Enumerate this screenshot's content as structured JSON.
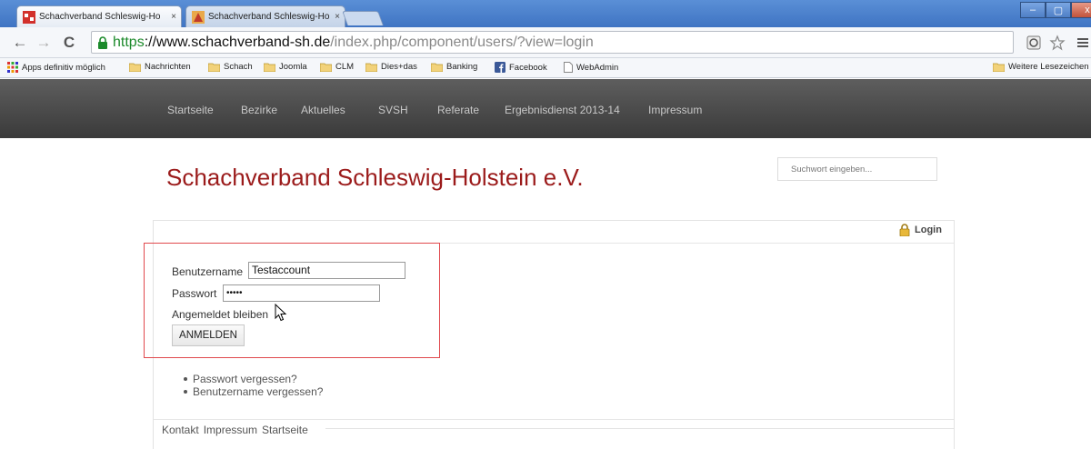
{
  "browser": {
    "tabs": [
      {
        "title": "Schachverband Schleswig-Ho",
        "close": "×"
      },
      {
        "title": "Schachverband Schleswig-Ho",
        "close": "×"
      }
    ],
    "url": {
      "scheme": "https",
      "host": "://www.schachverband-sh.de",
      "path": "/index.php/component/users/?view=login"
    },
    "bookmarks": [
      {
        "label": "Apps definitiv möglich",
        "icon": "apps-grid-icon"
      },
      {
        "label": "Nachrichten",
        "icon": "folder-icon"
      },
      {
        "label": "Schach",
        "icon": "folder-icon"
      },
      {
        "label": "Joomla",
        "icon": "folder-icon"
      },
      {
        "label": "CLM",
        "icon": "folder-icon"
      },
      {
        "label": "Dies+das",
        "icon": "folder-icon"
      },
      {
        "label": "Banking",
        "icon": "folder-icon"
      },
      {
        "label": "Facebook",
        "icon": "facebook-icon"
      },
      {
        "label": "WebAdmin",
        "icon": "page-icon"
      }
    ],
    "other_bookmarks": "Weitere Lesezeichen",
    "window_controls": {
      "minimize": "–",
      "maximize": "▢",
      "close": "x"
    }
  },
  "site": {
    "nav": [
      "Startseite",
      "Bezirke",
      "Aktuelles",
      "SVSH",
      "Referate",
      "Ergebnisdienst 2013-14",
      "Impressum"
    ],
    "title": "Schachverband Schleswig-Holstein e.V.",
    "search_placeholder": "Suchwort eingeben...",
    "login_link": "Login",
    "form": {
      "username_label": "Benutzername",
      "username_value": "Testaccount",
      "password_label": "Passwort",
      "password_value": "•••••",
      "remember_label": "Angemeldet bleiben",
      "submit_label": "ANMELDEN"
    },
    "links": [
      "Passwort vergessen?",
      "Benutzername vergessen?"
    ],
    "footer": [
      "Kontakt",
      "Impressum",
      "Startseite"
    ]
  },
  "colors": {
    "title": "#9b1b1b",
    "nav_bg": "#3a3a3a",
    "highlight": "#e0494d",
    "url_secure": "#1c8a2b"
  }
}
